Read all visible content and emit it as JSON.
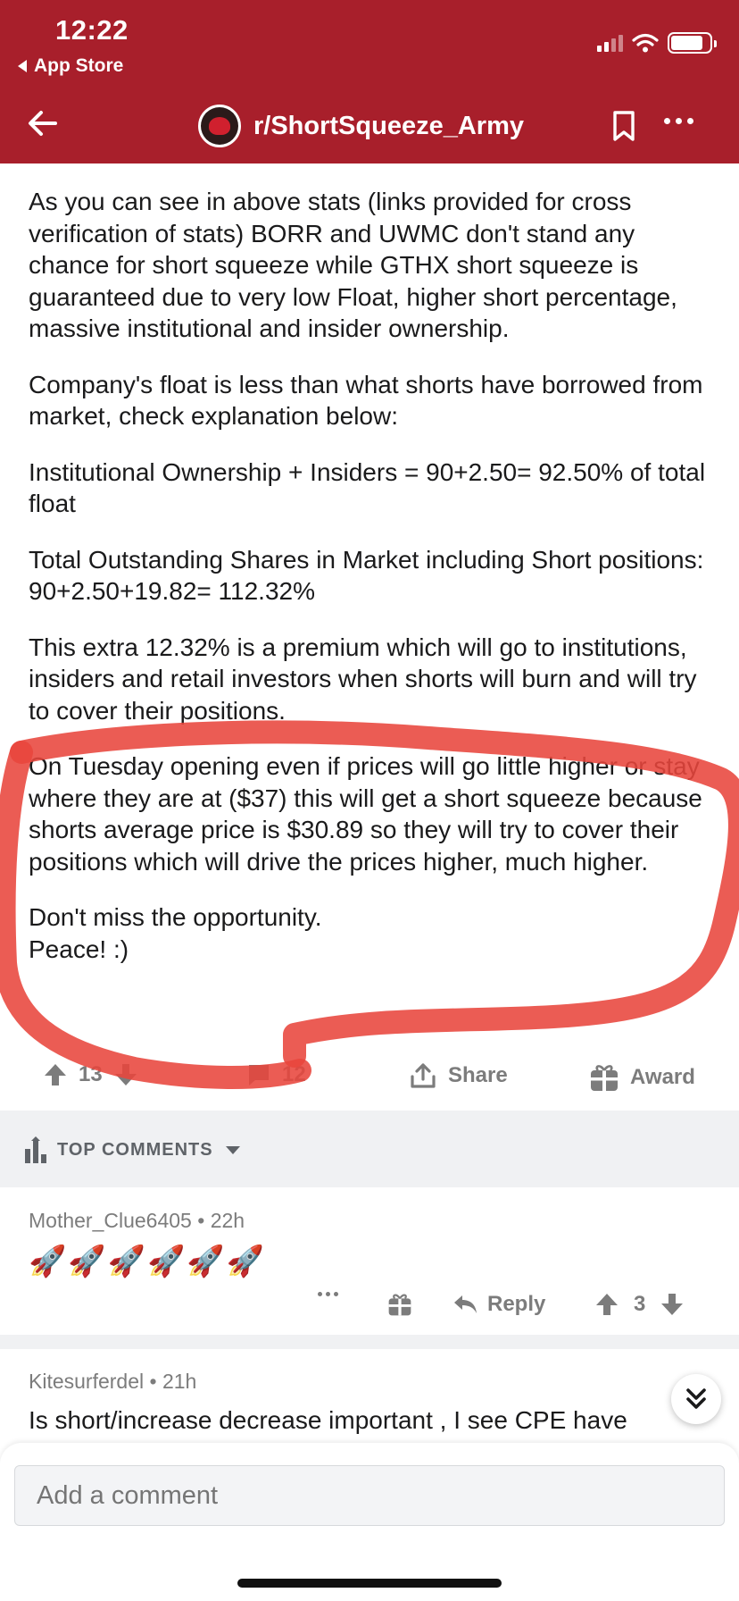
{
  "status_bar": {
    "time": "12:22",
    "back_app": "App Store"
  },
  "header": {
    "subreddit": "r/ShortSqueeze_Army"
  },
  "post": {
    "paragraphs": [
      "As you can see in above stats (links provided for cross verification of stats) BORR and UWMC don't stand any chance for short squeeze while GTHX short squeeze is guaranteed due to very low Float, higher short percentage, massive institutional and insider ownership.",
      "Company's float is less than what shorts have borrowed from market, check explanation below:",
      "Institutional Ownership + Insiders = 90+2.50= 92.50% of total float",
      "Total Outstanding Shares in Market including Short positions: 90+2.50+19.82= 112.32%",
      "This extra 12.32% is a premium which will go to institutions, insiders and retail investors when shorts will burn and will try to cover their positions.",
      "On Tuesday opening even if prices will go little higher or stay where they are at ($37) this will get a short squeeze because shorts average price is $30.89 so they will try to cover their positions which will drive the prices higher, much higher.",
      "Don't miss the opportunity.",
      "Peace! :)"
    ],
    "votes": "13",
    "comments": "12",
    "share_label": "Share",
    "award_label": "Award"
  },
  "comments_section": {
    "sort_label": "TOP COMMENTS"
  },
  "comments": [
    {
      "author": "Mother_Clue6405",
      "age": "22h",
      "body": "🚀🚀🚀🚀🚀🚀",
      "reply_label": "Reply",
      "votes": "3"
    },
    {
      "author": "Kitesurferdel",
      "age": "21h",
      "body": "Is short/increase decrease important , I see CPE have"
    }
  ],
  "composer": {
    "placeholder": "Add a comment"
  },
  "colors": {
    "header_bg": "#a81f2b",
    "annotation_red": "#e8453c"
  }
}
